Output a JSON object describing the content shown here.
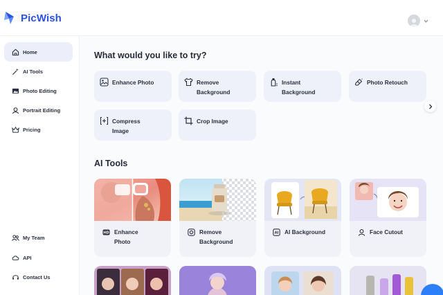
{
  "header": {
    "brand": "PicWish",
    "brand_color": "#2a53e0"
  },
  "sidebar": {
    "items": [
      {
        "label": "Home",
        "icon": "home-icon",
        "active": true
      },
      {
        "label": "AI Tools",
        "icon": "magic-wand-icon"
      },
      {
        "label": "Photo Editing",
        "icon": "image-edit-icon"
      },
      {
        "label": "Portrait Editing",
        "icon": "portrait-icon"
      },
      {
        "label": "Pricing",
        "icon": "crown-icon"
      }
    ],
    "bottom_items": [
      {
        "label": "My Team",
        "icon": "team-icon"
      },
      {
        "label": "API",
        "icon": "api-icon"
      },
      {
        "label": "Contact Us",
        "icon": "headset-icon"
      }
    ]
  },
  "main": {
    "try_title": "What would you like to try?",
    "quick_actions": [
      {
        "label": "Enhance Photo",
        "icon": "enhance-icon"
      },
      {
        "label": "Remove Background",
        "icon": "shirt-icon"
      },
      {
        "label": "Instant Background",
        "icon": "bottle-icon"
      },
      {
        "label": "Photo Retouch",
        "icon": "eraser-icon"
      },
      {
        "label": "Compress Image",
        "icon": "compress-icon"
      },
      {
        "label": "Crop Image",
        "icon": "crop-icon"
      }
    ],
    "ai_tools_title": "AI Tools",
    "ai_tools": [
      {
        "label": "Enhance Photo",
        "icon": "hd-icon"
      },
      {
        "label": "Remove Background",
        "icon": "cutout-icon"
      },
      {
        "label": "AI Background",
        "icon": "ai-icon"
      },
      {
        "label": "Face Cutout",
        "icon": "person-icon"
      }
    ]
  }
}
